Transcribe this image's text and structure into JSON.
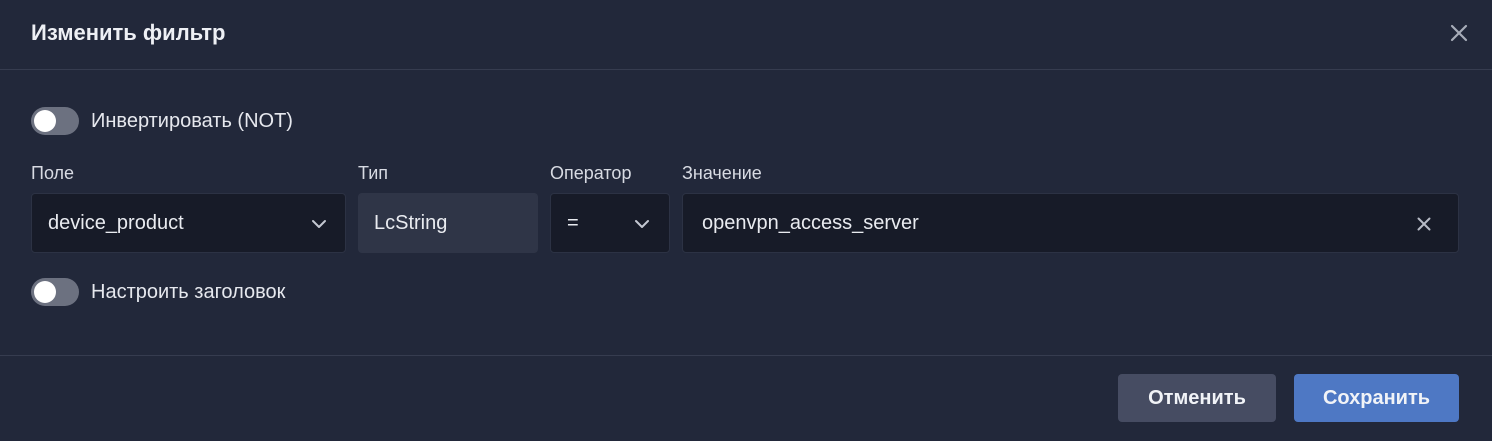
{
  "dialog": {
    "title": "Изменить фильтр",
    "close_icon": "close-icon"
  },
  "invert": {
    "label": "Инвертировать (NOT)",
    "enabled": false
  },
  "fields": {
    "field": {
      "label": "Поле",
      "value": "device_product"
    },
    "type": {
      "label": "Тип",
      "value": "LcString"
    },
    "operator": {
      "label": "Оператор",
      "value": "="
    },
    "value": {
      "label": "Значение",
      "value": "openvpn_access_server"
    }
  },
  "custom_title": {
    "label": "Настроить заголовок",
    "enabled": false
  },
  "footer": {
    "cancel_label": "Отменить",
    "save_label": "Сохранить"
  },
  "colors": {
    "background": "#22283a",
    "input_bg": "#171b28",
    "accent": "#4e78c4",
    "secondary_button": "#464c62",
    "toggle_off": "#6c7180"
  }
}
